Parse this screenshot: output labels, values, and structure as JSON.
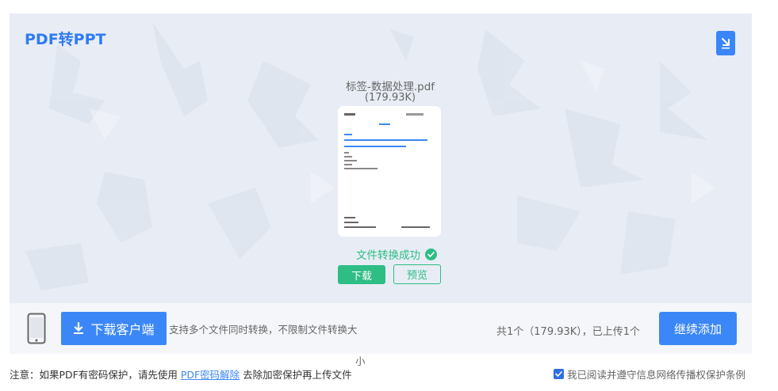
{
  "app": {
    "title": "PDF转PPT"
  },
  "file": {
    "name": "标签-数据处理.pdf",
    "size": "(179.93K)",
    "status": "文件转换成功"
  },
  "actions": {
    "download": "下载",
    "preview": "预览"
  },
  "toolbar": {
    "client_button": "下载客户端",
    "support_text": "支持多个文件同时转换，不限制文件转换大",
    "support_text_wrap": "小",
    "count_text": "共1个（179.93K），已上传1个",
    "continue_button": "继续添加"
  },
  "footer": {
    "notice_prefix": "注意：如果PDF有密码保护，请先使用 ",
    "notice_link": "PDF密码解除",
    "notice_suffix": " 去除加密保护再上传文件",
    "agree_checked": true,
    "agree_text": "我已阅读并遵守信息网络传播权保护条例"
  },
  "colors": {
    "accent": "#3c87f7",
    "title": "#2f7bf5",
    "success": "#2dbd85",
    "panel": "#e8edf5"
  },
  "icons": {
    "corner": "download-arrow-icon",
    "check": "check-circle-icon",
    "phone": "phone-icon",
    "download": "download-icon",
    "checkbox": "checkbox-checked-icon"
  }
}
